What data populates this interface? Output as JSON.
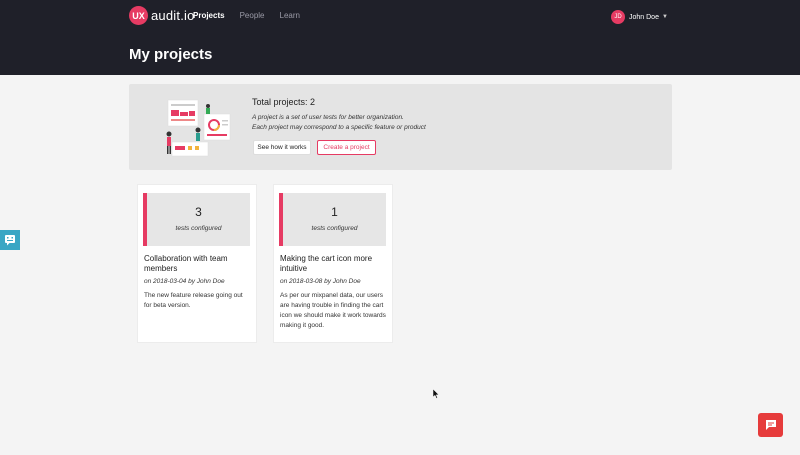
{
  "header": {
    "logo_badge": "UX",
    "logo_text": "audit.io",
    "nav": [
      {
        "label": "Projects"
      },
      {
        "label": "People"
      },
      {
        "label": "Learn"
      }
    ],
    "user": {
      "initials": "JD",
      "name": "John Doe"
    },
    "page_title": "My projects"
  },
  "intro": {
    "title": "Total projects: 2",
    "desc_line1": "A project is a set of user tests for better organization.",
    "desc_line2": "Each project may correspond to a specific feature or product",
    "how_button": "See how it works",
    "create_button": "Create a project"
  },
  "projects": [
    {
      "count": "3",
      "count_label": "tests configured",
      "title": "Collaboration with team members",
      "meta": "on 2018-03-04 by John Doe",
      "description": "The new feature release going out for beta version."
    },
    {
      "count": "1",
      "count_label": "tests configured",
      "title": "Making the cart icon more intuitive",
      "meta": "on 2018-03-08 by John Doe",
      "description": "As per our mixpanel data, our users are having trouble in finding the cart icon we should make it work towards making it good."
    }
  ],
  "widgets": {
    "feedback_icon": "feedback-icon",
    "chat_icon": "chat-icon"
  },
  "colors": {
    "accent": "#e63b63",
    "header_bg": "#1f2029",
    "feedback": "#3aa6c4",
    "chat": "#e63b3b"
  }
}
